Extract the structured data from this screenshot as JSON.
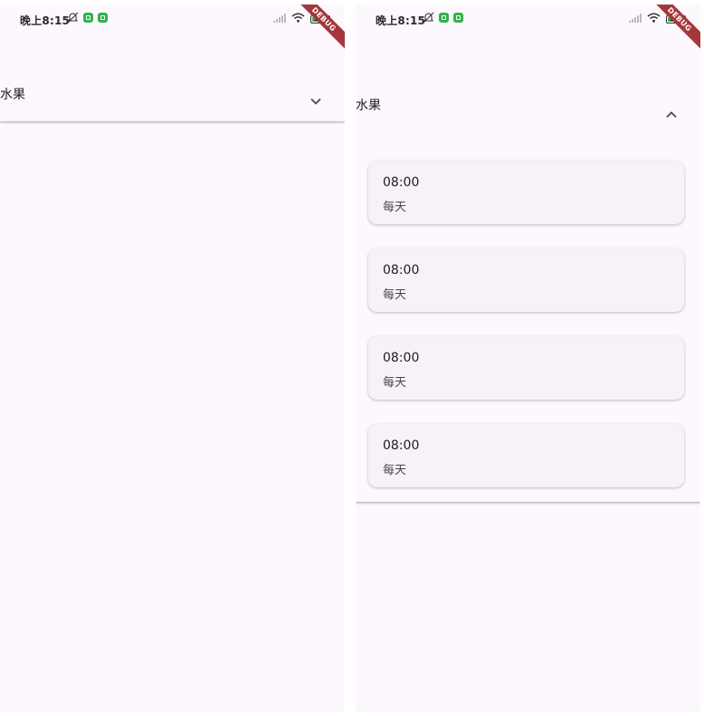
{
  "status_bar": {
    "time": "晚上8:15",
    "battery_level": "100"
  },
  "debug_banner": "DEBUG",
  "colors": {
    "background": "#fdf7fe",
    "card": "#f6f2f7",
    "badge_green": "#2fb34a",
    "ribbon": "#a5373b"
  },
  "left_screen": {
    "tile": {
      "title": "水果",
      "expanded": false,
      "chevron_icon": "chevron-down-icon"
    }
  },
  "right_screen": {
    "tile": {
      "title": "水果",
      "expanded": true,
      "chevron_icon": "chevron-up-icon",
      "items": [
        {
          "time": "08:00",
          "repeat": "每天"
        },
        {
          "time": "08:00",
          "repeat": "每天"
        },
        {
          "time": "08:00",
          "repeat": "每天"
        },
        {
          "time": "08:00",
          "repeat": "每天"
        }
      ]
    }
  }
}
